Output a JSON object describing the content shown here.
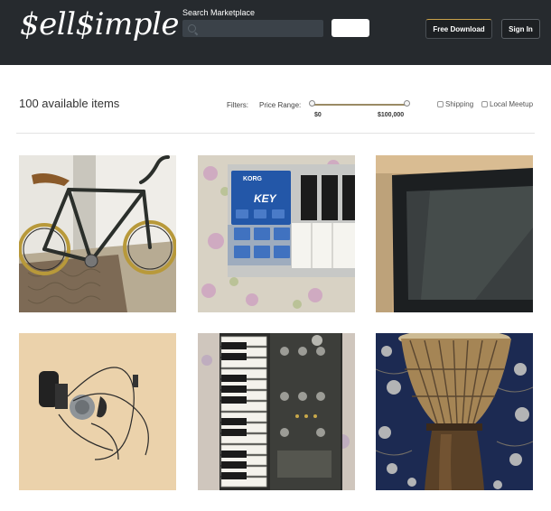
{
  "header": {
    "logo": "$ell$imple",
    "search_label": "Search Marketplace",
    "search_placeholder": "",
    "search_button": "",
    "download_button": "Free Download",
    "signin_button": "Sign In"
  },
  "filters": {
    "item_count": "100 available items",
    "filters_label": "Filters:",
    "price_range_label": "Price Range:",
    "price_min": "$0",
    "price_max": "$100,000",
    "shipping_label": "Shipping",
    "local_meetup_label": "Local Meetup"
  },
  "listings": [
    {
      "item": "bicycle"
    },
    {
      "item": "korg-keyboard",
      "brand_text": "KORG",
      "model_text": "KEY"
    },
    {
      "item": "tablet"
    },
    {
      "item": "headset"
    },
    {
      "item": "microkorg-synth"
    },
    {
      "item": "djembe-drum"
    }
  ],
  "colors": {
    "header_bg": "#262a2e",
    "search_bg": "#3b4249",
    "accent_gold": "#c9a14a",
    "korg_blue": "#2357a8"
  }
}
